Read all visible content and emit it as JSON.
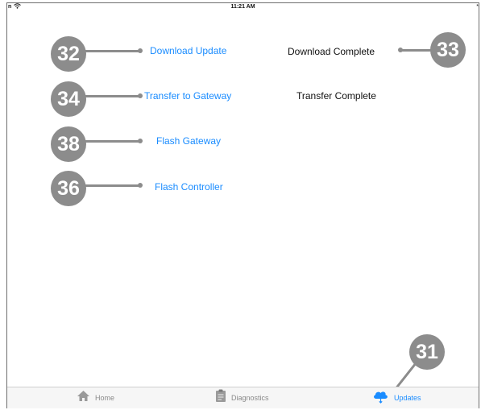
{
  "status_bar": {
    "carrier": "n",
    "time": "11:21 AM",
    "bluetooth": "*"
  },
  "actions": {
    "download_update": "Download Update",
    "transfer_to_gateway": "Transfer to Gateway",
    "flash_gateway": "Flash Gateway",
    "flash_controller": "Flash Controller"
  },
  "status": {
    "download": "Download Complete",
    "transfer": "Transfer Complete"
  },
  "callouts": {
    "c32": "32",
    "c33": "33",
    "c34": "34",
    "c38": "38",
    "c36": "36",
    "c31": "31"
  },
  "tabbar": {
    "home": "Home",
    "diagnostics": "Diagnostics",
    "updates": "Updates",
    "active": "updates"
  },
  "colors": {
    "accent": "#1a8cff",
    "callout": "#8c8c8c",
    "text": "#111111"
  },
  "icons": [
    "wifi-icon",
    "bluetooth-icon",
    "home-icon",
    "clipboard-icon",
    "cloud-download-icon"
  ]
}
